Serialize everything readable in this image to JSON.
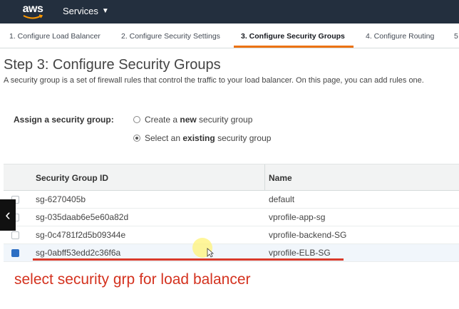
{
  "nav": {
    "logo": "aws",
    "services_label": "Services",
    "services_caret": "▼"
  },
  "wizard": {
    "tabs": [
      {
        "label": "1. Configure Load Balancer",
        "active": false
      },
      {
        "label": "2. Configure Security Settings",
        "active": false
      },
      {
        "label": "3. Configure Security Groups",
        "active": true
      },
      {
        "label": "4. Configure Routing",
        "active": false
      },
      {
        "label": "5",
        "active": false
      }
    ],
    "accent_color": "#ec7211"
  },
  "page": {
    "title": "Step 3: Configure Security Groups",
    "description": "A security group is a set of firewall rules that control the traffic to your load balancer. On this page, you can add rules one."
  },
  "assign": {
    "label": "Assign a security group:",
    "options": [
      {
        "pre": "Create a ",
        "bold": "new",
        "post": " security group",
        "checked": false
      },
      {
        "pre": "Select an ",
        "bold": "existing",
        "post": " security group",
        "checked": true
      }
    ]
  },
  "table": {
    "headers": {
      "id": "Security Group ID",
      "name": "Name"
    },
    "rows": [
      {
        "id": "sg-6270405b",
        "name": "default",
        "selected": false
      },
      {
        "id": "sg-035daab6e5e60a82d",
        "name": "vprofile-app-sg",
        "selected": false
      },
      {
        "id": "sg-0c4781f2d5b09344e",
        "name": "vprofile-backend-SG",
        "selected": false
      },
      {
        "id": "sg-0abff53edd2c36f6a",
        "name": "vprofile-ELB-SG",
        "selected": true
      }
    ]
  },
  "annotation": {
    "text": "select security grp for load balancer",
    "color": "#d4321f"
  },
  "overlay": {
    "prev_arrow_icon": "chevron-left-icon",
    "prev_arrow_glyph": "‹"
  }
}
